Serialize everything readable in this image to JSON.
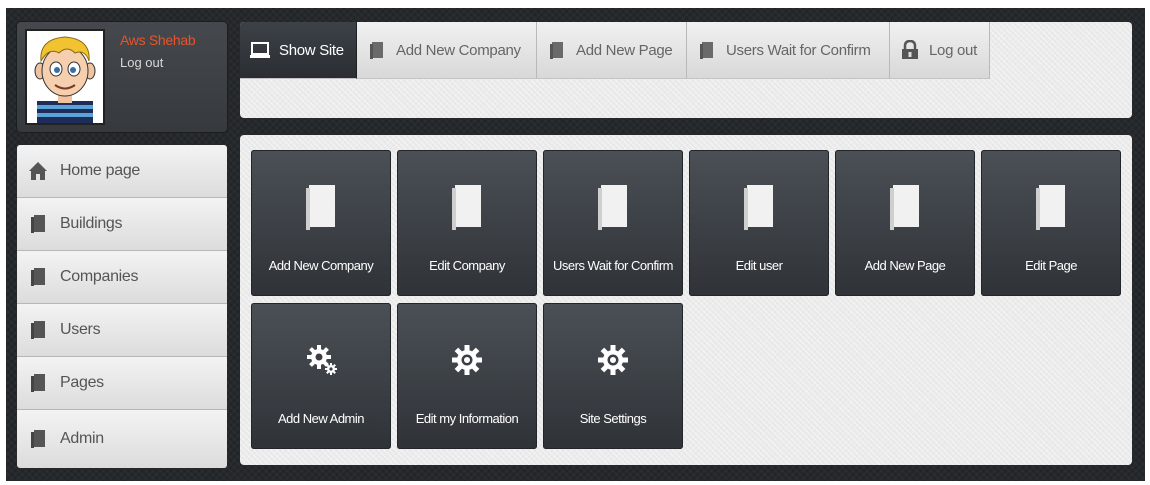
{
  "user": {
    "name": "Aws Shehab",
    "logout_label": "Log out"
  },
  "topnav": [
    {
      "label": "Show Site",
      "icon": "monitor-icon"
    },
    {
      "label": "Add New Company",
      "icon": "document-icon"
    },
    {
      "label": "Add New Page",
      "icon": "document-icon"
    },
    {
      "label": "Users Wait for Confirm",
      "icon": "document-icon"
    },
    {
      "label": "Log out",
      "icon": "lock-icon"
    }
  ],
  "sidebar": [
    {
      "label": "Home page",
      "icon": "home-icon"
    },
    {
      "label": "Buildings",
      "icon": "document-icon"
    },
    {
      "label": "Companies",
      "icon": "document-icon"
    },
    {
      "label": "Users",
      "icon": "document-icon"
    },
    {
      "label": "Pages",
      "icon": "document-icon"
    },
    {
      "label": "Admin",
      "icon": "document-icon"
    }
  ],
  "tiles": [
    {
      "label": "Add New Company",
      "icon": "document-icon"
    },
    {
      "label": "Edit Company",
      "icon": "document-icon"
    },
    {
      "label": "Users Wait for Confirm",
      "icon": "document-icon"
    },
    {
      "label": "Edit user",
      "icon": "document-icon"
    },
    {
      "label": "Add New Page",
      "icon": "document-icon"
    },
    {
      "label": "Edit Page",
      "icon": "document-icon"
    },
    {
      "label": "Add New Admin",
      "icon": "gears-icon"
    },
    {
      "label": "Edit my Information",
      "icon": "gear-icon"
    },
    {
      "label": "Site Settings",
      "icon": "gear-icon"
    }
  ],
  "colors": {
    "frame": "#26292c",
    "accent_name": "#e8542a",
    "tile_top": "#4b5056",
    "tile_bottom": "#2f3338",
    "panel": "#ebebeb"
  }
}
